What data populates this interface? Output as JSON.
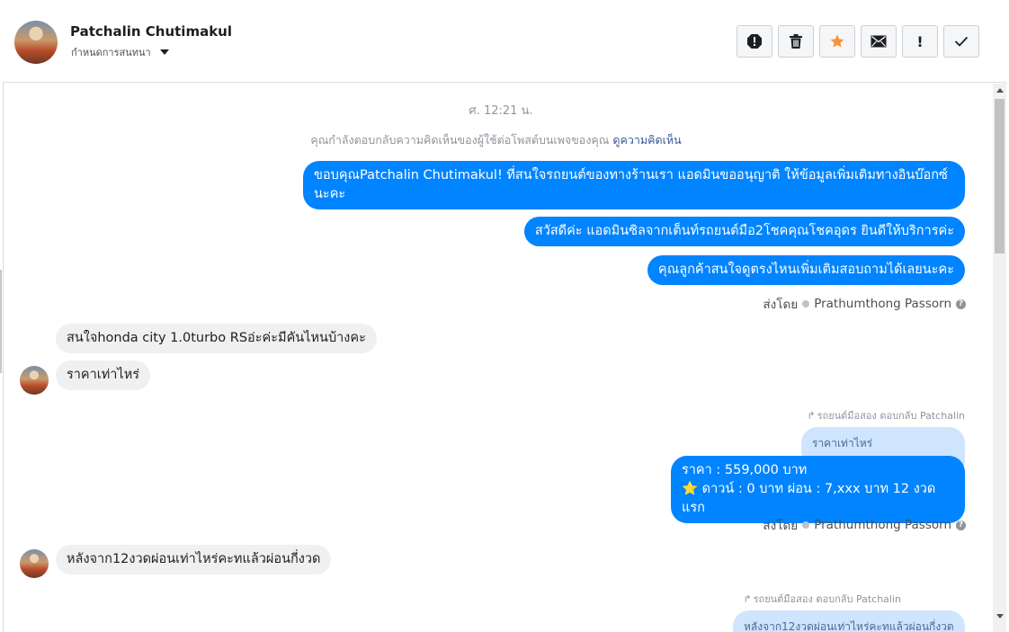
{
  "header": {
    "contact_name": "Patchalin Chutimakul",
    "subtitle": "กำหนดการสนทนา"
  },
  "toolbar": {
    "buttons": [
      {
        "icon": "alert-circle-icon"
      },
      {
        "icon": "trash-icon"
      },
      {
        "icon": "star-icon",
        "color": "#f7923a"
      },
      {
        "icon": "mail-icon"
      },
      {
        "icon": "exclamation-icon",
        "label": "!"
      },
      {
        "icon": "check-icon"
      }
    ]
  },
  "chat": {
    "timestamp": "ศ. 12:21 น.",
    "info_text": "คุณกำลังตอบกลับความคิดเห็นของผู้ใช้ต่อโพสต์บนเพจของคุณ",
    "info_link": "ดูความคิดเห็น",
    "messages": [
      {
        "dir": "out",
        "text": "ขอบคุณPatchalin Chutimakul! ที่สนใจรถยนต์ของทางร้านเรา แอดมินขออนุญาติ ให้ข้อมูลเพิ่มเติมทางอินบ๊อกซ์นะคะ"
      },
      {
        "dir": "out",
        "text": "สวัสดีค่ะ แอดมินซิลจากเต็นท์รถยนต์มือ2โชคคุณโชคอุดร ยินดีให้บริการค่ะ"
      },
      {
        "dir": "out",
        "text": "คุณลูกค้าสนใจดูตรงไหนเพิ่มเติมสอบถามได้เลยนะคะ"
      },
      {
        "dir": "in",
        "text": "สนใจhonda city 1.0turbo RSอ่ะค่ะมีคันไหนบ้างคะ"
      },
      {
        "dir": "in",
        "text": "ราคาเท่าไหร่"
      },
      {
        "dir": "out",
        "text_line1": "ราคา : 559,000 บาท",
        "text_line2": "⭐ ดาวน์ : 0 บาท ผ่อน : 7,xxx บาท 12 งวดแรก"
      },
      {
        "dir": "in",
        "text": "หลังจาก12งวดผ่อนเท่าไหร่คะทแล้วผ่อนกี่งวด"
      }
    ],
    "sent_by_label": "ส่งโดย",
    "sent_by_name": "Prathumthong Passorn",
    "reply_note_1": "รถยนต์มือสอง ตอบกลับ Patchalin",
    "quoted_1": "ราคาเท่าไหร่",
    "reply_note_2": "รถยนต์มือสอง ตอบกลับ Patchalin",
    "quoted_2": "หลังจาก12งวดผ่อนเท่าไหร่คะทแล้วผ่อนกี่งวด"
  },
  "colors": {
    "outgoing_bubble": "#0084ff",
    "incoming_bubble": "#f1f0f0",
    "quoted_bubble": "#cfe4fd",
    "link": "#385898"
  }
}
